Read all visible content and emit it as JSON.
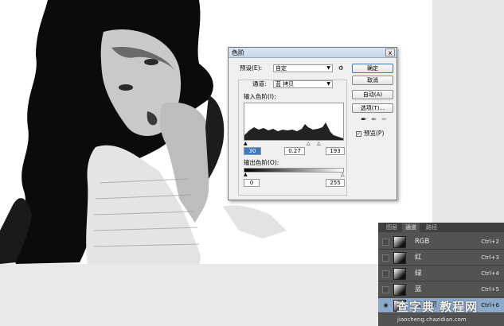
{
  "levels_dialog": {
    "title": "色阶",
    "close_label": "x",
    "preset_label": "预设(E):",
    "preset_value": "自定",
    "channel_label": "通道:",
    "channel_value": "蓝 拷贝",
    "input_levels_label": "输入色阶(I):",
    "input_black": "30",
    "input_gamma": "0.27",
    "input_white": "193",
    "output_levels_label": "输出色阶(O):",
    "output_black": "0",
    "output_white": "255",
    "buttons": {
      "ok": "确定",
      "cancel": "取消",
      "auto": "自动(A)",
      "options": "选项(T)..."
    },
    "preview_label": "预览(P)",
    "preview_checked": true
  },
  "channels_panel": {
    "tabs": [
      "图层",
      "通道",
      "路径"
    ],
    "active_tab": "通道",
    "channels": [
      {
        "name": "RGB",
        "shortcut": "Ctrl+2",
        "visible": false,
        "selected": false
      },
      {
        "name": "红",
        "shortcut": "Ctrl+3",
        "visible": false,
        "selected": false
      },
      {
        "name": "绿",
        "shortcut": "Ctrl+4",
        "visible": false,
        "selected": false
      },
      {
        "name": "蓝",
        "shortcut": "Ctrl+5",
        "visible": false,
        "selected": false
      },
      {
        "name": "蓝 拷贝",
        "shortcut": "Ctrl+6",
        "visible": true,
        "selected": true
      }
    ]
  },
  "watermark": {
    "main": "查字典 教程网",
    "url": "jiaocheng.chazidian.com"
  }
}
